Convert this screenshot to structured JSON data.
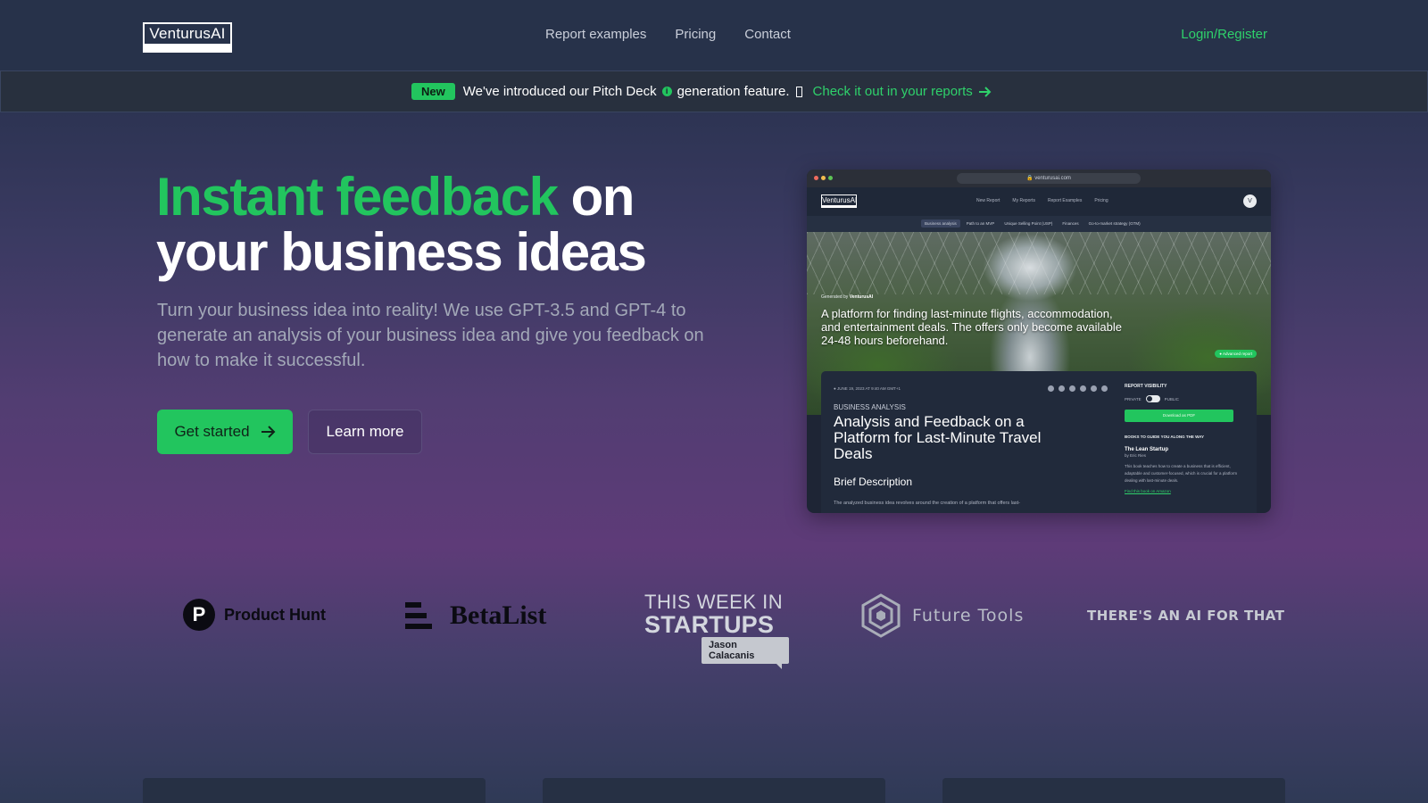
{
  "nav": {
    "logo": "VenturusAI",
    "links": [
      "Report examples",
      "Pricing",
      "Contact"
    ],
    "login": "Login/Register"
  },
  "banner": {
    "badge": "New",
    "text_before": "We've introduced our Pitch Deck",
    "text_after": "generation feature.",
    "link": "Check it out in your reports"
  },
  "hero": {
    "title_green": "Instant feedback",
    "title_rest_line1": " on",
    "title_line2": "your business ideas",
    "subtitle": "Turn your business idea into reality! We use GPT-3.5 and GPT-4 to generate an analysis of your business idea and give you feedback on how to make it successful.",
    "primary_button": "Get started",
    "secondary_button": "Learn more"
  },
  "preview": {
    "url": "venturusai.com",
    "logo": "VenturusAI",
    "nav_links": [
      "New Report",
      "My Reports",
      "Report Examples",
      "Pricing"
    ],
    "avatar": "V",
    "tabs": [
      "Business analysis",
      "Path to an MVP",
      "Unique Selling Point (USP)",
      "Finances",
      "Go-to-market strategy (GTM)"
    ],
    "generated_by_label": "Generated by",
    "generated_by_name": "VenturusAI",
    "headline": "A platform for finding last-minute flights, accommodation, and entertainment deals. The offers only become available 24-48 hours beforehand.",
    "advanced_pill": "● Advanced report",
    "date": "●  JUNE 19, 2023 AT 9:40 AM GMT+1",
    "category": "BUSINESS ANALYSIS",
    "report_title": "Analysis and Feedback on a Platform for Last-Minute Travel Deals",
    "brief_heading": "Brief Description",
    "brief_text": "The analyzed business idea revolves around the creation of a platform that offers last-",
    "visibility_heading": "REPORT VISIBILITY",
    "visibility_private": "PRIVATE",
    "visibility_public": "PUBLIC",
    "download_button": "Download as PDF",
    "books_heading": "BOOKS TO GUIDE YOU ALONG THE WAY",
    "book_title": "The Lean Startup",
    "book_author": "by Eric Ries",
    "book_desc": "This book teaches how to create a business that is efficient, adaptable and customer-focused, which is crucial for a platform dealing with last-minute deals.",
    "book_link": "Find this book on Amazon"
  },
  "logos": {
    "product_hunt_letter": "P",
    "product_hunt": "Product Hunt",
    "betalist": "BetaList",
    "twis_line1": "THIS WEEK IN",
    "twis_line2": "STARTUPS",
    "twis_tag": "Jason Calacanis",
    "future_tools": "Future Tools",
    "aift": "THERE'S AN AI FOR THAT"
  },
  "colors": {
    "accent": "#22c55e",
    "nav_bg": "#27324a"
  }
}
